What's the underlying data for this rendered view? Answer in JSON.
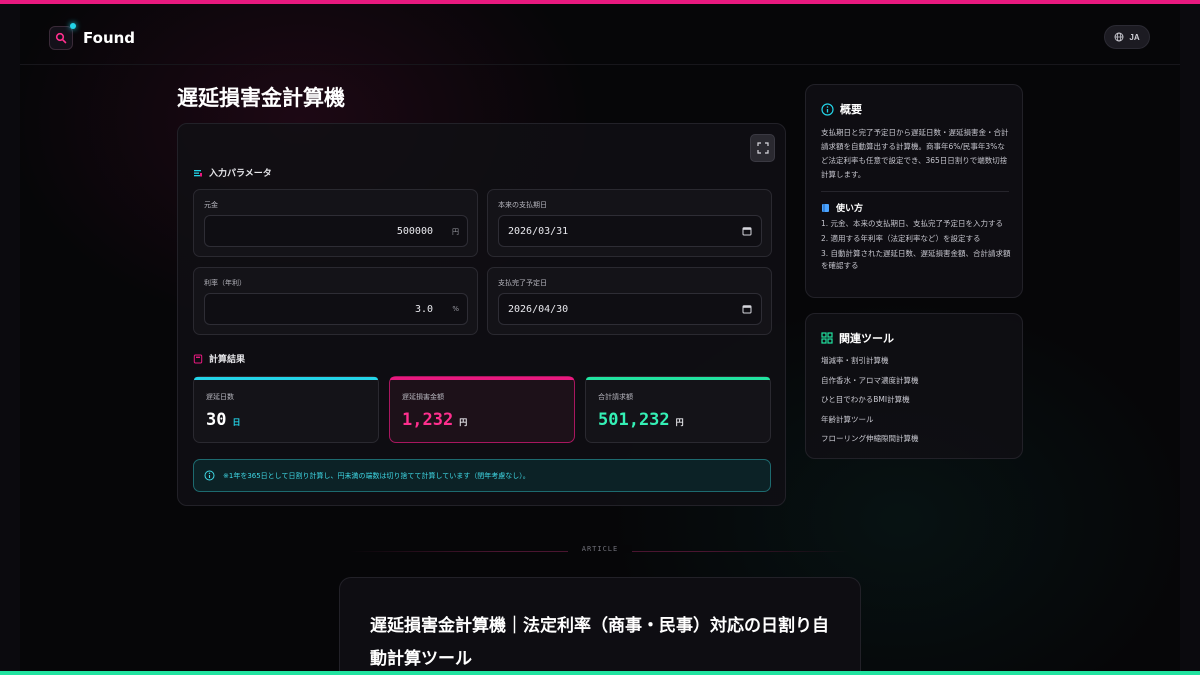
{
  "app": {
    "name": "Found",
    "language_label": "JA",
    "colors": {
      "accent_pink": "#e8197f",
      "accent_cyan": "#23d4e8",
      "accent_green": "#21e3a0",
      "background": "#060608"
    }
  },
  "page": {
    "title": "遅延損害金計算機"
  },
  "calculator": {
    "input_section_label": "入力パラメータ",
    "fields": {
      "principal": {
        "label": "元金",
        "value": "500000",
        "unit": "円"
      },
      "due_date": {
        "label": "本来の支払期日",
        "value": "2026/03/31"
      },
      "rate": {
        "label": "利率（年利）",
        "value": "3.0",
        "unit": "%"
      },
      "payment_date": {
        "label": "支払完了予定日",
        "value": "2026/04/30"
      }
    },
    "result_section_label": "計算結果",
    "results": {
      "days": {
        "label": "遅延日数",
        "value": "30",
        "unit": "日"
      },
      "damages": {
        "label": "遅延損害金額",
        "value": "1,232",
        "unit": "円"
      },
      "total": {
        "label": "合計請求額",
        "value": "501,232",
        "unit": "円"
      }
    },
    "note": "※1年を365日として日割り計算し、円未満の端数は切り捨てて計算しています（閏年考慮なし）。"
  },
  "sidebar": {
    "overview": {
      "title": "概要",
      "text": "支払期日と完了予定日から遅延日数・遅延損害金・合計請求額を自動算出する計算機。商事年6%/民事年3%など法定利率も任意で設定でき、365日日割りで端数切捨計算します。",
      "usage_title": "使い方",
      "usage_steps": [
        "1. 元金、本来の支払期日、支払完了予定日を入力する",
        "2. 適用する年利率（法定利率など）を設定する",
        "3. 自動計算された遅延日数、遅延損害金額、合計請求額を確認する"
      ]
    },
    "related": {
      "title": "関連ツール",
      "items": [
        "増減率・割引計算機",
        "自作香水・アロマ濃度計算機",
        "ひと目でわかるBMI計算機",
        "年齢計算ツール",
        "フローリング伸縮隙間計算機"
      ]
    }
  },
  "article": {
    "section_label": "ARTICLE",
    "title": "遅延損害金計算機｜法定利率（商事・民事）対応の日割り自動計算ツール"
  }
}
